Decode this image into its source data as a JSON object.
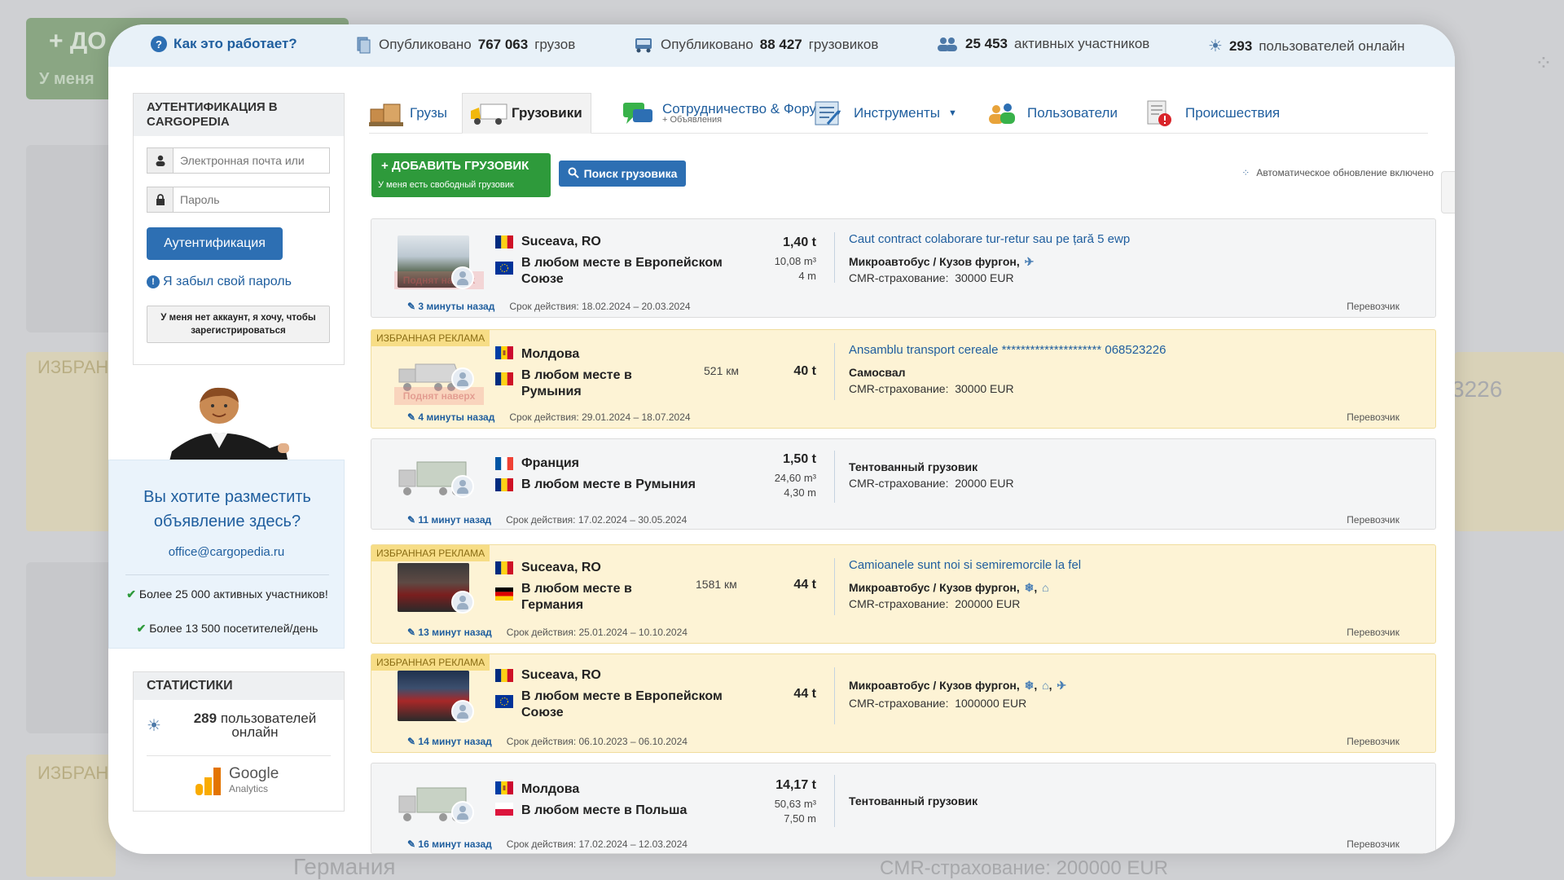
{
  "stats": {
    "help": "Как это работает?",
    "cargo_prefix": "Опубликовано",
    "cargo_count": "767 063",
    "cargo_suffix": "грузов",
    "trucks_prefix": "Опубликовано",
    "trucks_count": "88 427",
    "trucks_suffix": "грузовиков",
    "members_count": "25 453",
    "members_suffix": "активных участников",
    "online_count": "293",
    "online_suffix": "пользователей онлайн"
  },
  "auth": {
    "title": "АУТЕНТИФИКАЦИЯ В CARGOPEDIA",
    "email_placeholder": "Электронная почта или",
    "password_placeholder": "Пароль",
    "login_button": "Аутентификация",
    "forgot": "Я забыл свой пароль",
    "register": "У меня нет аккаунт, я хочу, чтобы зарегистрироваться"
  },
  "promo": {
    "question": "Вы хотите разместить объявление здесь?",
    "email": "office@cargopedia.ru",
    "point1": "Более 25 000 активных участников!",
    "point2": "Более 13 500 посетителей/день"
  },
  "statistics": {
    "title": "СТАТИСТИКИ",
    "users_count": "289",
    "users_label": "пользователей онлайн",
    "ga_name": "Google",
    "ga_sub": "Analytics"
  },
  "tabs": [
    {
      "label": "Грузы"
    },
    {
      "label": "Грузовики"
    },
    {
      "label": "Сотрудничество & Форум",
      "sub": "+ Объявления"
    },
    {
      "label": "Инструменты"
    },
    {
      "label": "Пользователи"
    },
    {
      "label": "Происшествия"
    }
  ],
  "actions": {
    "add_truck": "ДОБАВИТЬ ГРУЗОВИК",
    "add_truck_sub": "У меня есть свободный грузовик",
    "search_truck": "Поиск грузовика",
    "auto_update": "Автоматическое обновление включено"
  },
  "listings": [
    {
      "featured": false,
      "from": "Suceava, RO",
      "to": "В любом месте в Европейском Союзе",
      "distance": "",
      "weight": "1,40 t",
      "volume": "10,08 m³",
      "length": "4 m",
      "title": "Caut contract colaborare tur-retur sau pe țară 5 ewp",
      "type": "Микроавтобус / Кузов фургон,",
      "insurance_label": "CMR-страхование:",
      "insurance": "30000 EUR",
      "ago": "3 минуты назад",
      "validity": "Срок действия: 18.02.2024 – 20.03.2024",
      "carrier": "Перевозчик",
      "raise": "Поднят наверх"
    },
    {
      "featured": true,
      "featured_label": "ИЗБРАННАЯ РЕКЛАМА",
      "from": "Молдова",
      "to": "В любом месте в Румыния",
      "distance": "521 км",
      "weight": "40 t",
      "volume": "",
      "length": "",
      "title": "Ansamblu transport cereale ********************* 068523226",
      "type": "Самосвал",
      "insurance_label": "CMR-страхование:",
      "insurance": "30000 EUR",
      "ago": "4 минуты назад",
      "validity": "Срок действия: 29.01.2024 – 18.07.2024",
      "carrier": "Перевозчик",
      "raise": "Поднят наверх"
    },
    {
      "featured": false,
      "from": "Франция",
      "to": "В любом месте в Румыния",
      "distance": "",
      "weight": "1,50 t",
      "volume": "24,60 m³",
      "length": "4,30 m",
      "title": "",
      "type": "Тентованный грузовик",
      "insurance_label": "CMR-страхование:",
      "insurance": "20000 EUR",
      "ago": "11 минут назад",
      "validity": "Срок действия: 17.02.2024 – 30.05.2024",
      "carrier": "Перевозчик"
    },
    {
      "featured": true,
      "featured_label": "ИЗБРАННАЯ РЕКЛАМА",
      "from": "Suceava, RO",
      "to": "В любом месте в Германия",
      "distance": "1581 км",
      "weight": "44 t",
      "volume": "",
      "length": "",
      "title": "Camioanele sunt noi si semiremorcile la fel",
      "type": "Микроавтобус / Кузов фургон,",
      "insurance_label": "CMR-страхование:",
      "insurance": "200000 EUR",
      "ago": "13 минут назад",
      "validity": "Срок действия: 25.01.2024 – 10.10.2024",
      "carrier": "Перевозчик"
    },
    {
      "featured": true,
      "featured_label": "ИЗБРАННАЯ РЕКЛАМА",
      "from": "Suceava, RO",
      "to": "В любом месте в Европейском Союзе",
      "distance": "",
      "weight": "44 t",
      "volume": "",
      "length": "",
      "title": "",
      "type": "Микроавтобус / Кузов фургон,",
      "insurance_label": "CMR-страхование:",
      "insurance": "1000000 EUR",
      "ago": "14 минут назад",
      "validity": "Срок действия: 06.10.2023 – 06.10.2024",
      "carrier": "Перевозчик"
    },
    {
      "featured": false,
      "from": "Молдова",
      "to": "В любом месте в Польша",
      "distance": "",
      "weight": "14,17 t",
      "volume": "50,63 m³",
      "length": "7,50 m",
      "title": "",
      "type": "Тентованный грузовик",
      "insurance_label": "",
      "insurance": "",
      "ago": "16 минут назад",
      "validity": "Срок действия: 17.02.2024 – 12.03.2024",
      "carrier": "Перевозчик"
    }
  ],
  "colors": {
    "brand_blue": "#2d6fb3",
    "link_blue": "#1f5e9e",
    "green": "#2e9a3b",
    "featured_bg": "#fdf3d5"
  },
  "icons": [
    "question-icon",
    "documents-icon",
    "truck-icon",
    "users-icon",
    "sun-icon",
    "user-icon",
    "lock-icon",
    "search-icon",
    "snowflake-icon",
    "gps-icon",
    "satellite-icon"
  ],
  "background": {
    "phone": "3226",
    "bottom_place": "Германия",
    "bottom_insurance": "CMR-страхование:  200000 EUR",
    "featured": "ИЗБРАН",
    "add_hint": "+ ДО",
    "add_sub": "У меня"
  }
}
